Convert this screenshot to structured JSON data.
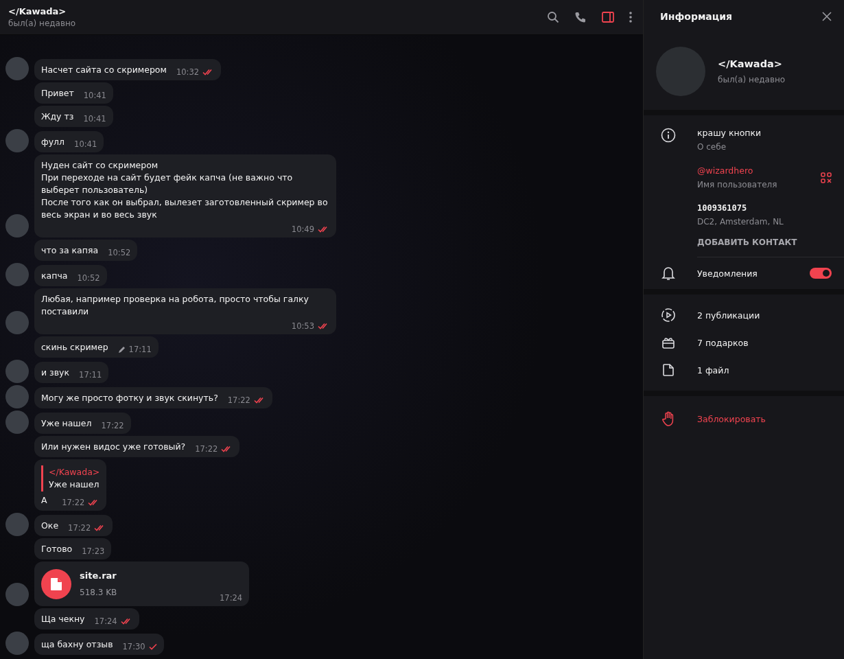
{
  "chat_header": {
    "title": "</Kawada>",
    "status": "был(а) недавно"
  },
  "messages": [
    {
      "kind": "text",
      "text": "Насчет сайта со скримером",
      "time": "10:32",
      "outgoing": true,
      "read": true,
      "avatar": true,
      "edited": false
    },
    {
      "kind": "text",
      "text": "Привет",
      "time": "10:41",
      "outgoing": false,
      "avatar": false,
      "edited": false
    },
    {
      "kind": "text",
      "text": "Жду тз",
      "time": "10:41",
      "outgoing": false,
      "avatar": false,
      "edited": false
    },
    {
      "kind": "text",
      "text": "фулл",
      "time": "10:41",
      "outgoing": false,
      "avatar": true,
      "edited": false
    },
    {
      "kind": "text",
      "text": "Нуден сайт со скримером\nПри переходе на сайт будет фейк капча (не важно что выберет пользователь)\nПосле того как он выбрал, вылезет заготовленный скример во весь экран и во весь звук",
      "time": "10:49",
      "outgoing": true,
      "read": true,
      "avatar": true,
      "edited": false
    },
    {
      "kind": "text",
      "text": "что за капяа",
      "time": "10:52",
      "outgoing": false,
      "avatar": false,
      "edited": false
    },
    {
      "kind": "text",
      "text": "капча",
      "time": "10:52",
      "outgoing": false,
      "avatar": true,
      "edited": false
    },
    {
      "kind": "text",
      "text": "Любая, например проверка на робота, просто чтобы галку поставили",
      "time": "10:53",
      "outgoing": true,
      "read": true,
      "avatar": true,
      "edited": false
    },
    {
      "kind": "text",
      "text": "скинь скример",
      "time": "17:11",
      "outgoing": false,
      "avatar": false,
      "edited": true
    },
    {
      "kind": "text",
      "text": "и звук",
      "time": "17:11",
      "outgoing": false,
      "avatar": true,
      "edited": false
    },
    {
      "kind": "text",
      "text": "Могу же просто фотку и звук скинуть?",
      "time": "17:22",
      "outgoing": true,
      "read": true,
      "avatar": true,
      "edited": false
    },
    {
      "kind": "text",
      "text": "Уже нашел",
      "time": "17:22",
      "outgoing": false,
      "avatar": true,
      "edited": false
    },
    {
      "kind": "text",
      "text": "Или нужен видос уже готовый?",
      "time": "17:22",
      "outgoing": true,
      "read": true,
      "avatar": false,
      "edited": false
    },
    {
      "kind": "reply",
      "reply_author": "</Kawada>",
      "reply_text": "Уже нашел",
      "text": "А",
      "time": "17:22",
      "outgoing": true,
      "read": true,
      "avatar": false,
      "edited": false
    },
    {
      "kind": "text",
      "text": "Оке",
      "time": "17:22",
      "outgoing": true,
      "read": true,
      "avatar": true,
      "edited": false
    },
    {
      "kind": "text",
      "text": "Готово",
      "time": "17:23",
      "outgoing": false,
      "avatar": false,
      "edited": false
    },
    {
      "kind": "file",
      "file_name": "site.rar",
      "file_size": "518.3 KB",
      "time": "17:24",
      "outgoing": false,
      "avatar": true,
      "edited": false
    },
    {
      "kind": "text",
      "text": "Ща чекну",
      "time": "17:24",
      "outgoing": true,
      "read": true,
      "avatar": false,
      "edited": false
    },
    {
      "kind": "text",
      "text": "ща бахну отзыв",
      "time": "17:30",
      "outgoing": true,
      "read": false,
      "avatar": true,
      "edited": false
    }
  ],
  "info_panel": {
    "title": "Информация",
    "name": "</Kawada>",
    "status": "был(а) недавно",
    "about": {
      "value": "крашу кнопки",
      "label": "О себе"
    },
    "username": {
      "value": "@wizardhero",
      "label": "Имя пользователя"
    },
    "user_id": {
      "value": "1009361075",
      "label": "DC2, Amsterdam, NL"
    },
    "add_contact": "ДОБАВИТЬ КОНТАКТ",
    "notifications": {
      "label": "Уведомления",
      "on": true
    },
    "media": [
      {
        "kind": "stories",
        "label": "2 публикации"
      },
      {
        "kind": "gifts",
        "label": "7 подарков"
      },
      {
        "kind": "files",
        "label": "1 файл"
      }
    ],
    "block": "Заблокировать"
  }
}
